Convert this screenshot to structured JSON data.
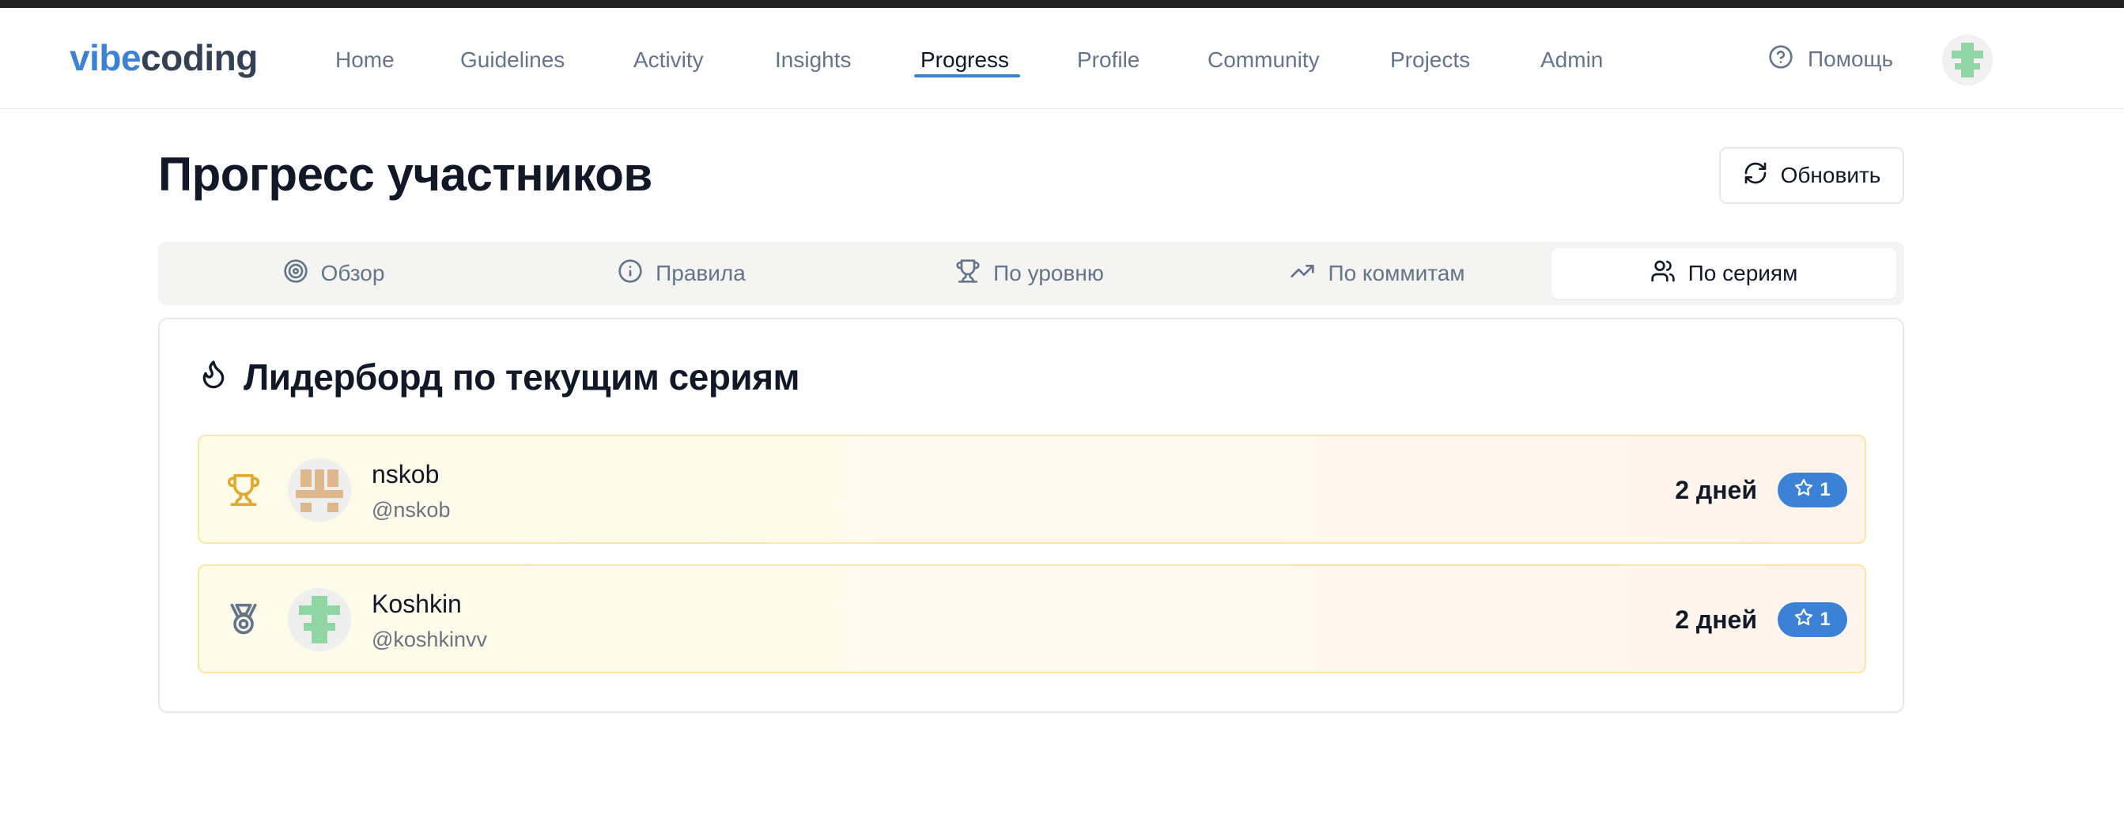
{
  "header": {
    "logo_part1": "vibe",
    "logo_part2": "coding",
    "nav": [
      {
        "label": "Home"
      },
      {
        "label": "Guidelines"
      },
      {
        "label": "Activity"
      },
      {
        "label": "Insights"
      },
      {
        "label": "Progress",
        "active": true
      },
      {
        "label": "Profile"
      },
      {
        "label": "Community"
      },
      {
        "label": "Projects"
      },
      {
        "label": "Admin"
      }
    ],
    "help_label": "Помощь"
  },
  "page": {
    "title": "Прогресс участников",
    "refresh_label": "Обновить"
  },
  "tabs": [
    {
      "label": "Обзор",
      "icon": "target-icon"
    },
    {
      "label": "Правила",
      "icon": "info-icon"
    },
    {
      "label": "По уровню",
      "icon": "trophy-icon"
    },
    {
      "label": "По коммитам",
      "icon": "trending-up-icon"
    },
    {
      "label": "По сериям",
      "icon": "users-icon",
      "active": true
    }
  ],
  "leaderboard": {
    "title": "Лидерборд по текущим сериям",
    "rows": [
      {
        "name": "nskob",
        "handle": "@nskob",
        "days": "2 дней",
        "badge": "1",
        "medal": "trophy-icon"
      },
      {
        "name": "Koshkin",
        "handle": "@koshkinvv",
        "days": "2 дней",
        "badge": "1",
        "medal": "medal-icon"
      }
    ]
  },
  "colors": {
    "accent": "#3b82d6",
    "row_border": "#fbe7a1",
    "trophy_gold": "#e0a82e"
  }
}
